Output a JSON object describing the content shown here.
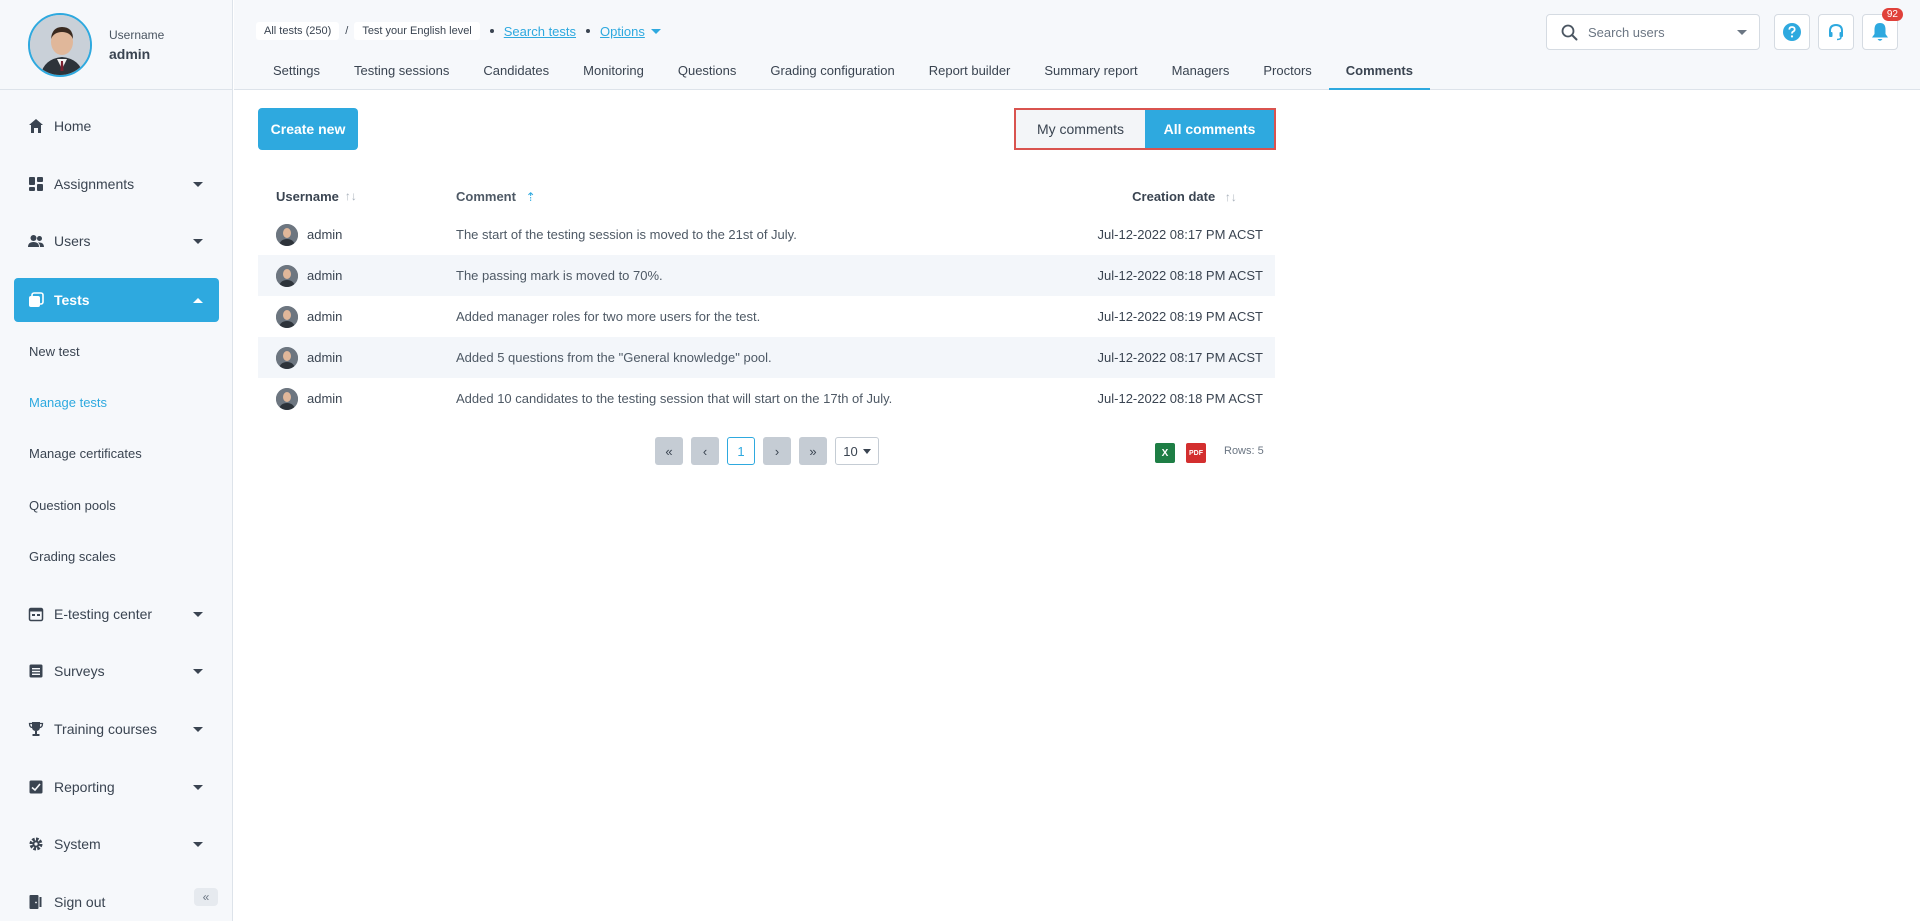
{
  "profile": {
    "label": "Username",
    "name": "admin"
  },
  "sidebar": {
    "items": [
      {
        "label": "Home",
        "icon": "home-icon"
      },
      {
        "label": "Assignments",
        "icon": "dashboard-icon"
      },
      {
        "label": "Users",
        "icon": "users-icon"
      },
      {
        "label": "Tests",
        "icon": "tests-icon"
      },
      {
        "label": "E-testing center",
        "icon": "calendar-icon"
      },
      {
        "label": "Surveys",
        "icon": "list-icon"
      },
      {
        "label": "Training courses",
        "icon": "trophy-icon"
      },
      {
        "label": "Reporting",
        "icon": "report-icon"
      },
      {
        "label": "System",
        "icon": "gear-icon"
      },
      {
        "label": "Sign out",
        "icon": "sign-out-icon"
      }
    ],
    "sub_items": [
      "New test",
      "Manage tests",
      "Manage certificates",
      "Question pools",
      "Grading scales"
    ],
    "active_item": "Tests",
    "active_sub_item": "Manage tests"
  },
  "breadcrumb": {
    "all_tests": "All tests (250)",
    "separator": "/",
    "current": "Test your English level",
    "search_link": "Search tests",
    "options_link": "Options"
  },
  "tabs": [
    "Settings",
    "Testing sessions",
    "Candidates",
    "Monitoring",
    "Questions",
    "Grading configuration",
    "Report builder",
    "Summary report",
    "Managers",
    "Proctors",
    "Comments"
  ],
  "active_tab": "Comments",
  "search": {
    "placeholder": "Search users"
  },
  "notifications": {
    "count": "92"
  },
  "actions": {
    "create_new": "Create new"
  },
  "toggle": {
    "mine": "My comments",
    "all": "All comments",
    "selected": "All comments"
  },
  "table": {
    "headers": {
      "username": "Username",
      "comment": "Comment",
      "date": "Creation date"
    },
    "rows": [
      {
        "user": "admin",
        "comment": "The start of the testing session is moved to the 21st of July.",
        "date": "Jul-12-2022 08:17 PM ACST"
      },
      {
        "user": "admin",
        "comment": "The passing mark is moved to 70%.",
        "date": "Jul-12-2022 08:18 PM ACST"
      },
      {
        "user": "admin",
        "comment": "Added manager roles for two more users for the test.",
        "date": "Jul-12-2022 08:19 PM ACST"
      },
      {
        "user": "admin",
        "comment": "Added 5 questions from the \"General knowledge\" pool.",
        "date": "Jul-12-2022 08:17 PM ACST"
      },
      {
        "user": "admin",
        "comment": "Added 10 candidates to the testing session that will start on the 17th of July.",
        "date": "Jul-12-2022 08:18 PM ACST"
      }
    ]
  },
  "pagination": {
    "current_page": "1",
    "page_size": "10",
    "rows_text": "Rows: 5"
  },
  "colors": {
    "accent": "#2ea9df",
    "highlight": "#d9534f",
    "badge": "#e0413a",
    "excel": "#1e7e45",
    "pdf": "#d32f2f"
  }
}
